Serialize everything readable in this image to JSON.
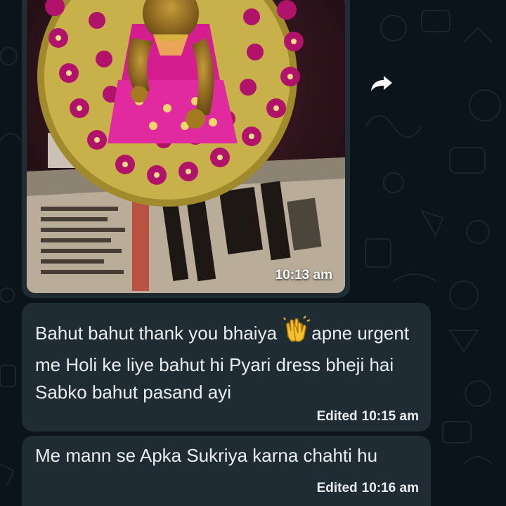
{
  "messages": [
    {
      "type": "image",
      "image_icon": "deity-idol-photo",
      "time": "10:13 am"
    },
    {
      "type": "text",
      "text_before_emoji": "Bahut bahut thank you bhaiya ",
      "emoji": "clapping-hands-icon",
      "text_after_emoji": "apne urgent me Holi ke liye bahut hi Pyari dress bheji hai Sabko bahut pasand ayi",
      "edited_label": "Edited",
      "time": "10:15 am"
    },
    {
      "type": "text",
      "text": "Me mann se Apka Sukriya karna chahti hu",
      "edited_label": "Edited",
      "time": "10:16 am"
    }
  ],
  "actions": {
    "forward_icon": "forward-arrow-icon"
  },
  "colors": {
    "background": "#0b141a",
    "bubble": "#1f2c34",
    "text": "#e9edef"
  }
}
